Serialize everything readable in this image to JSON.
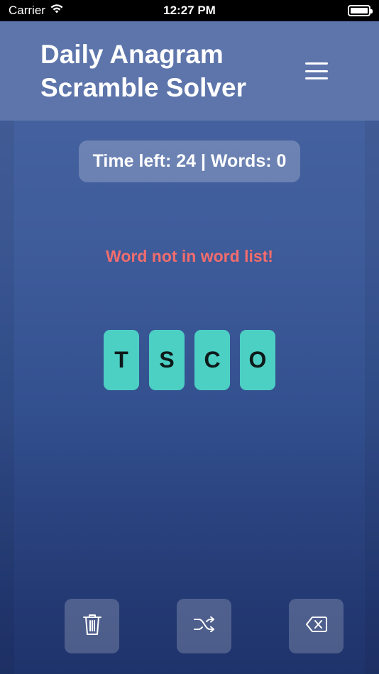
{
  "status_bar": {
    "carrier": "Carrier",
    "time": "12:27 PM"
  },
  "header": {
    "title": "Daily Anagram Scramble Solver",
    "menu_icon": "hamburger-menu-icon"
  },
  "game": {
    "stats": "Time left: 24 | Words: 0",
    "message": "Word not in word list!",
    "message_color": "#f26d6d",
    "tiles": [
      "T",
      "S",
      "C",
      "O"
    ],
    "tile_color": "#4dd0c4"
  },
  "actions": {
    "clear_icon": "trash-icon",
    "shuffle_icon": "shuffle-icon",
    "backspace_icon": "backspace-icon"
  }
}
